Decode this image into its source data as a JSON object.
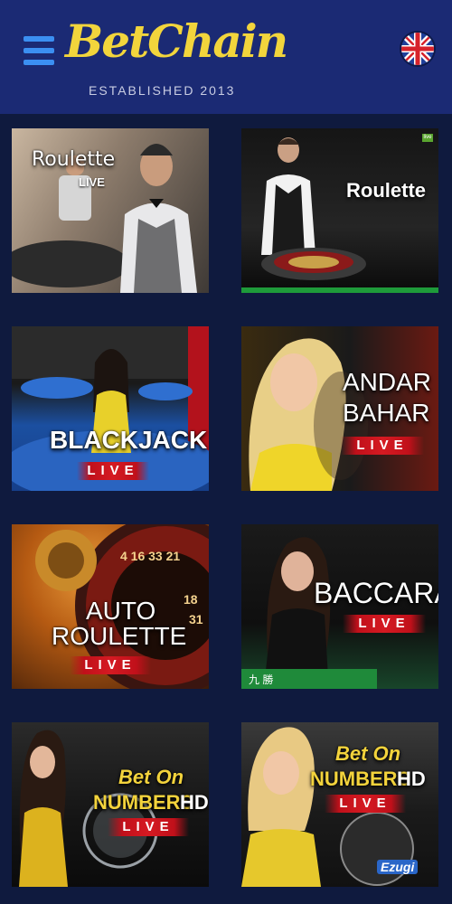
{
  "header": {
    "brand": "BetChain",
    "tagline": "ESTABLISHED 2013",
    "menu_icon": "hamburger-menu-icon",
    "flag_icon": "uk-flag-icon",
    "colors": {
      "bar": "#1b2a74",
      "logo": "#f2d53c",
      "menu": "#3b8ff2"
    }
  },
  "games": [
    {
      "title": "Roulette",
      "badge": "LIVE"
    },
    {
      "title": "Roulette",
      "badge": "live"
    },
    {
      "title": "BLACKJACK",
      "badge": "LIVE"
    },
    {
      "title_line1": "ANDAR",
      "title_line2": "BAHAR",
      "badge": "LIVE"
    },
    {
      "title_line1": "AUTO",
      "title_line2": "ROULETTE",
      "badge": "LIVE"
    },
    {
      "title": "BACCARAT",
      "badge": "LIVE"
    },
    {
      "title_line1": "Bet On",
      "title_line2": "NUMBERS",
      "hd": "HD",
      "badge": "LIVE"
    },
    {
      "title_line1": "Bet On",
      "title_line2": "NUMBERS",
      "hd": "HD",
      "badge": "LIVE",
      "provider": "Ezugi"
    }
  ]
}
